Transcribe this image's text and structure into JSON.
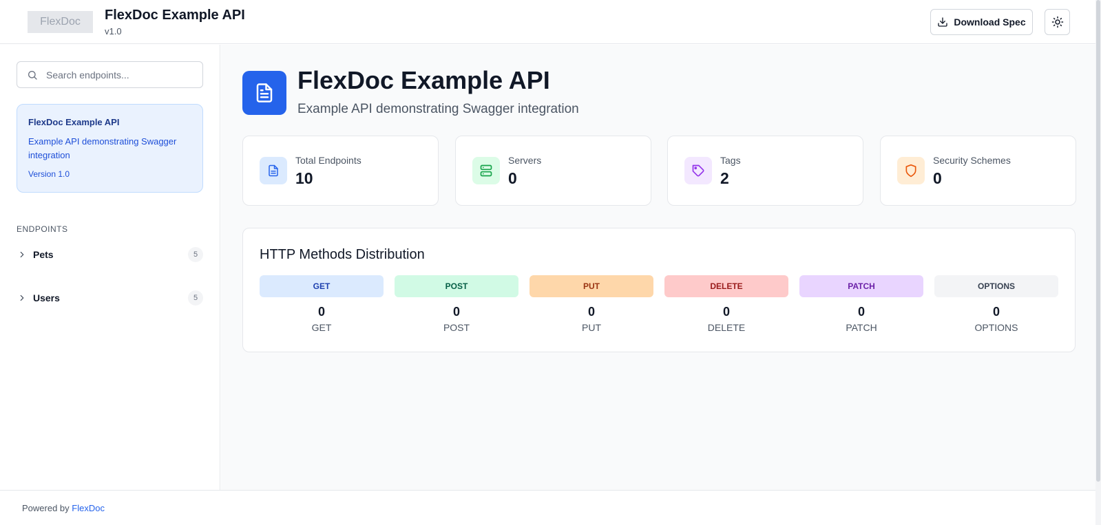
{
  "header": {
    "logo_text": "FlexDoc",
    "title": "FlexDoc Example API",
    "version": "v1.0",
    "download_label": "Download Spec"
  },
  "sidebar": {
    "search_placeholder": "Search endpoints...",
    "api_card": {
      "title": "FlexDoc Example API",
      "description": "Example API demonstrating Swagger integration",
      "version": "Version 1.0"
    },
    "section_label": "ENDPOINTS",
    "groups": [
      {
        "label": "Pets",
        "count": "5"
      },
      {
        "label": "Users",
        "count": "5"
      }
    ]
  },
  "main": {
    "title": "FlexDoc Example API",
    "subtitle": "Example API demonstrating Swagger integration",
    "stats": [
      {
        "label": "Total Endpoints",
        "value": "10",
        "icon": "document-icon",
        "color": "#2563eb",
        "bg": "#dbeafe"
      },
      {
        "label": "Servers",
        "value": "0",
        "icon": "server-icon",
        "color": "#16a34a",
        "bg": "#dcfce7"
      },
      {
        "label": "Tags",
        "value": "2",
        "icon": "tag-icon",
        "color": "#9333ea",
        "bg": "#f3e8ff"
      },
      {
        "label": "Security Schemes",
        "value": "0",
        "icon": "shield-icon",
        "color": "#ea580c",
        "bg": "#ffedd5"
      }
    ],
    "methods_title": "HTTP Methods Distribution",
    "methods": [
      {
        "badge": "GET",
        "count": "0",
        "name": "GET",
        "bg": "#dbeafe",
        "fg": "#1e40af"
      },
      {
        "badge": "POST",
        "count": "0",
        "name": "POST",
        "bg": "#d1fae5",
        "fg": "#065f46"
      },
      {
        "badge": "PUT",
        "count": "0",
        "name": "PUT",
        "bg": "#fed7aa",
        "fg": "#9a3412"
      },
      {
        "badge": "DELETE",
        "count": "0",
        "name": "DELETE",
        "bg": "#fecaca",
        "fg": "#991b1b"
      },
      {
        "badge": "PATCH",
        "count": "0",
        "name": "PATCH",
        "bg": "#e9d5ff",
        "fg": "#6b21a8"
      },
      {
        "badge": "OPTIONS",
        "count": "0",
        "name": "OPTIONS",
        "bg": "#f3f4f6",
        "fg": "#374151"
      }
    ]
  },
  "footer": {
    "prefix": "Powered by ",
    "link": "FlexDoc"
  }
}
